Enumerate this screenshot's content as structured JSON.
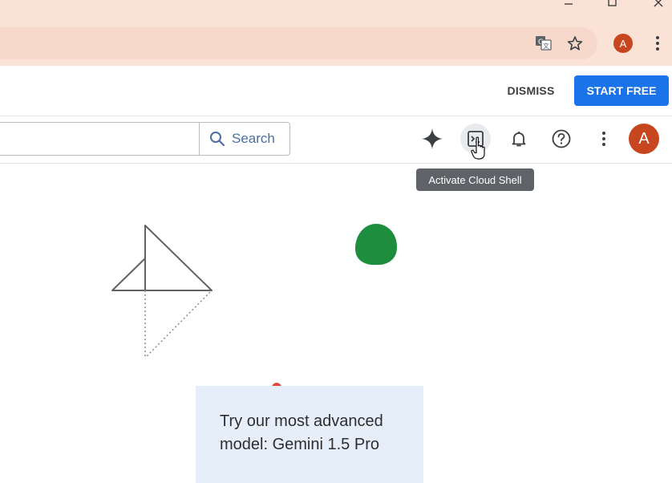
{
  "window": {
    "minimize_icon": "minimize-icon",
    "maximize_icon": "maximize-icon",
    "close_icon": "close-icon"
  },
  "browser": {
    "translate_icon": "translate-icon",
    "bookmark_icon": "star-icon",
    "profile_initial": "A",
    "menu_icon": "vertical-dots-icon"
  },
  "banner": {
    "dismiss_label": "DISMISS",
    "start_free_label": "START FREE"
  },
  "header": {
    "search": {
      "value": "",
      "placeholder": "",
      "button_label": "Search"
    },
    "icons": [
      "sparkle-icon",
      "cloud-shell-icon",
      "bell-icon",
      "help-icon",
      "vertical-dots-icon"
    ],
    "avatar_initial": "A",
    "tooltip": "Activate Cloud Shell"
  },
  "promo": {
    "text": "Try our most advanced model: Gemini 1.5 Pro"
  },
  "colors": {
    "title_bar": "#fbe2d6",
    "accent_blue": "#1a73e8",
    "avatar": "#c8461f",
    "green_shape": "#1e8e3e",
    "promo_card": "#e6eefa"
  }
}
